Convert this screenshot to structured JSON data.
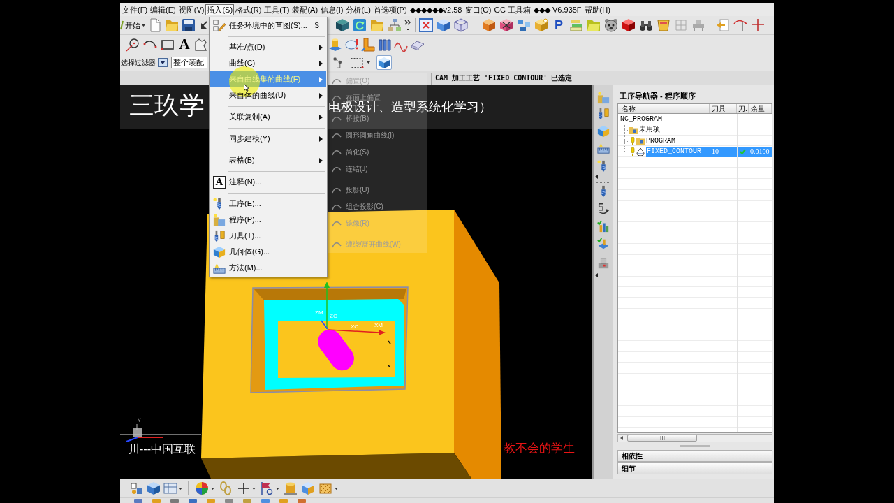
{
  "menu_bar": [
    {
      "label": "文件(F)",
      "selected": false
    },
    {
      "label": "编辑(E)",
      "selected": false
    },
    {
      "label": "视图(V)",
      "selected": false
    },
    {
      "label": "插入(S)",
      "selected": true
    },
    {
      "label": "格式(R)",
      "selected": false
    },
    {
      "label": "工具(T)",
      "selected": false
    },
    {
      "label": "装配(A)",
      "selected": false
    },
    {
      "label": "信息(I)",
      "selected": false
    },
    {
      "label": "分析(L)",
      "selected": false
    },
    {
      "label": "首选项(P)",
      "selected": false
    },
    {
      "label": "◆◆◆◆◆◆v2.58",
      "selected": false
    },
    {
      "label": "窗口(O)",
      "selected": false
    },
    {
      "label": "GC 工具箱",
      "selected": false
    },
    {
      "label": "◆◆◆ V6.935F",
      "selected": false
    },
    {
      "label": "帮助(H)",
      "selected": false
    }
  ],
  "toolbar": {
    "start_button": "开始",
    "post_glyph": "P",
    "text_glyph": "A",
    "selection_filter": "选择过滤器",
    "assembly_scope": "整个装配"
  },
  "status_line": "CAM 加工工艺 'FIXED_CONTOUR' 已选定",
  "insert_menu": [
    {
      "kind": "command",
      "label": "任务环境中的草图(S)...",
      "shortcut": "S",
      "selected": false
    },
    {
      "kind": "separator"
    },
    {
      "kind": "submenu",
      "label": "基准/点(D)",
      "selected": false
    },
    {
      "kind": "submenu",
      "label": "曲线(C)",
      "selected": false
    },
    {
      "kind": "submenu",
      "label": "来自曲线集的曲线(F)",
      "selected": true
    },
    {
      "kind": "submenu",
      "label": "来自体的曲线(U)",
      "selected": false
    },
    {
      "kind": "separator"
    },
    {
      "kind": "submenu",
      "label": "关联复制(A)",
      "selected": false
    },
    {
      "kind": "separator"
    },
    {
      "kind": "submenu",
      "label": "同步建模(Y)",
      "selected": false
    },
    {
      "kind": "separator"
    },
    {
      "kind": "submenu",
      "label": "表格(B)",
      "selected": false
    },
    {
      "kind": "separator"
    },
    {
      "kind": "command",
      "label": "注释(N)...",
      "glyph": "A",
      "selected": false
    },
    {
      "kind": "separator"
    },
    {
      "kind": "command",
      "label": "工序(E)...",
      "selected": false
    },
    {
      "kind": "command",
      "label": "程序(P)...",
      "selected": false
    },
    {
      "kind": "command",
      "label": "刀具(T)...",
      "selected": false
    },
    {
      "kind": "command",
      "label": "几何体(G)...",
      "selected": false
    },
    {
      "kind": "command",
      "label": "方法(M)...",
      "selected": false
    }
  ],
  "curve_submenu": [
    {
      "kind": "command",
      "label": "偏置(O)"
    },
    {
      "kind": "command",
      "label": "在面上偏置"
    },
    {
      "kind": "separator"
    },
    {
      "kind": "command",
      "label": "桥接(B)"
    },
    {
      "kind": "command",
      "label": "圆形圆角曲线(I)"
    },
    {
      "kind": "command",
      "label": "简化(S)"
    },
    {
      "kind": "command",
      "label": "连结(J)"
    },
    {
      "kind": "separator"
    },
    {
      "kind": "command",
      "label": "投影(U)"
    },
    {
      "kind": "command",
      "label": "组合投影(C)"
    },
    {
      "kind": "command",
      "label": "镜像(R)"
    },
    {
      "kind": "separator"
    },
    {
      "kind": "command",
      "label": "缠绕/展开曲线(W)"
    }
  ],
  "viewport": {
    "captions": [
      {
        "kind": "title",
        "text": "三玖学"
      },
      {
        "kind": "subtitle",
        "text": "电极设计、造型系统化学习）"
      },
      {
        "kind": "left_footer",
        "text": "川---中国互联"
      },
      {
        "kind": "right_footer",
        "text": "教不会的学生"
      }
    ],
    "axis_labels": [
      "ZM",
      "ZC",
      "XC",
      "XM"
    ],
    "triad_label": "Y"
  },
  "navigator": {
    "title": "工序导航器 - 程序顺序",
    "columns": [
      "名称",
      "刀具",
      "刀.",
      "余量"
    ],
    "tree": [
      {
        "name": "NC_PROGRAM",
        "selected": false,
        "flagged": false,
        "path_ok": false,
        "children": [
          {
            "name": "未用项",
            "kind": "group",
            "selected": false,
            "flagged": false,
            "path_ok": false
          },
          {
            "name": "PROGRAM",
            "kind": "program",
            "selected": false,
            "flagged": true,
            "path_ok": false
          },
          {
            "name": "FIXED_CONTOUR",
            "kind": "operation",
            "selected": true,
            "flagged": true,
            "path_ok": true,
            "tool": "10",
            "stock": "0.0100"
          }
        ]
      }
    ]
  },
  "panels": [
    {
      "label": "相依性"
    },
    {
      "label": "细节"
    }
  ]
}
